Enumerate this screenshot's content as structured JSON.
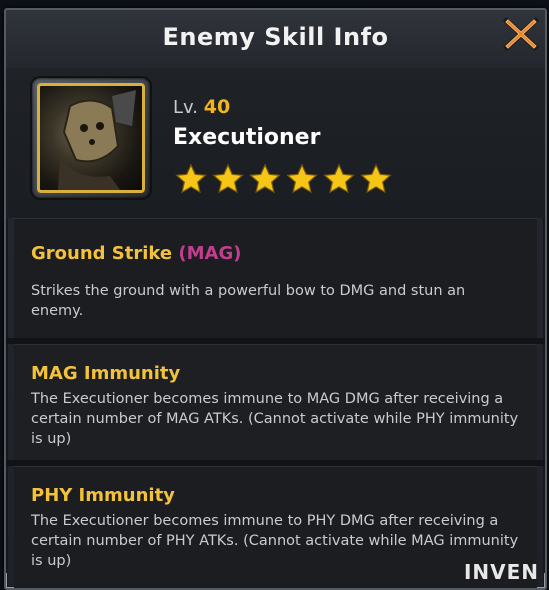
{
  "dialog": {
    "title": "Enemy Skill Info",
    "close_icon": "close-x-icon"
  },
  "enemy": {
    "level_label": "Lv.",
    "level": "40",
    "name": "Executioner",
    "stars": 6,
    "portrait_icon": "executioner-portrait",
    "class_icon": "shield-icon"
  },
  "skills": [
    {
      "name": "Ground Strike",
      "tag": "(MAG)",
      "description": "Strikes the ground with a powerful bow to DMG and stun an enemy."
    },
    {
      "name": "MAG Immunity",
      "tag": "",
      "description": "The Executioner becomes immune to MAG DMG after receiving a certain number of MAG ATKs. (Cannot activate while PHY immunity is up)"
    },
    {
      "name": "PHY Immunity",
      "tag": "",
      "description": "The Executioner becomes immune to PHY DMG after receiving a certain number of PHY ATKs. (Cannot activate while MAG immunity is up)"
    }
  ],
  "watermark": "INVEN",
  "colors": {
    "skill_name": "#f3c23a",
    "skill_tag": "#c23e8e",
    "level_value": "#f1b51e",
    "star": "#f5c518",
    "close": "#e8832a"
  }
}
